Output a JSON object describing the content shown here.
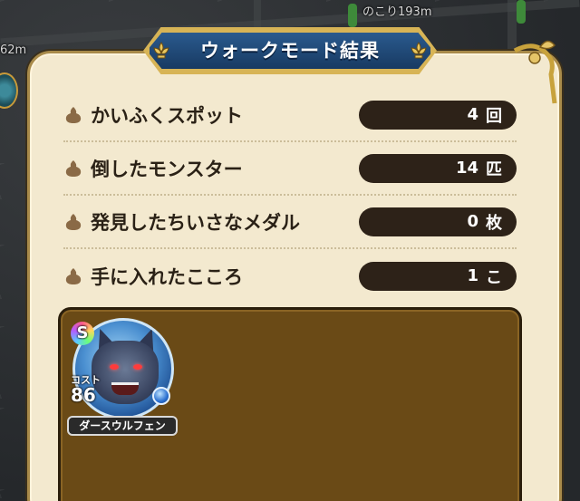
{
  "map": {
    "remaining_distance": "のこり193m",
    "side_distance": "62m"
  },
  "panel": {
    "title": "ウォークモード結果"
  },
  "results": [
    {
      "label": "かいふくスポット",
      "value": "4",
      "unit": "回"
    },
    {
      "label": "倒したモンスター",
      "value": "14",
      "unit": "匹"
    },
    {
      "label": "発見したちいさなメダル",
      "value": "0",
      "unit": "枚"
    },
    {
      "label": "手に入れたこころ",
      "value": "1",
      "unit": "こ"
    }
  ],
  "heart": {
    "rank": "S",
    "cost_label": "コスト",
    "cost": "86",
    "name": "ダースウルフェン",
    "element_icon": "water-element-icon"
  },
  "colors": {
    "panel_bg": "#f3e9cf",
    "title_plate": "#1f4a78",
    "gold_trim": "#d7b456",
    "value_pill": "#2d2218",
    "loot_box": "#6a4a16"
  }
}
